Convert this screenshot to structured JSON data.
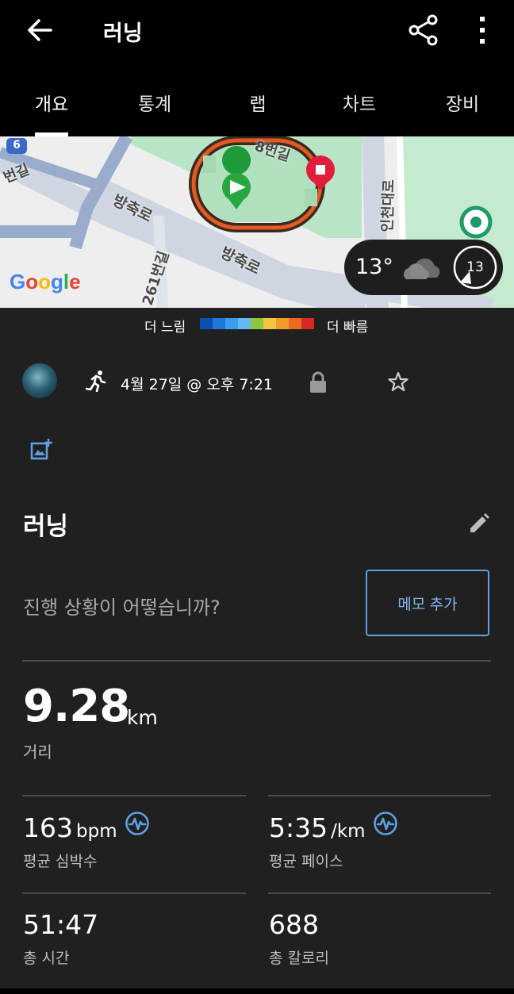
{
  "header": {
    "title": "러닝",
    "tabs": [
      "개요",
      "통계",
      "랩",
      "차트",
      "장비"
    ],
    "active_tab": 0
  },
  "map": {
    "road_labels": [
      "방축로",
      "방축로",
      "261번길",
      "인천대로",
      "8번길",
      "번길"
    ],
    "route_shield": "6",
    "google_logo_letters": [
      "G",
      "o",
      "o",
      "g",
      "l",
      "e"
    ],
    "weather": {
      "temperature": "13°",
      "condition_icon": "cloud-icon",
      "wind_speed": "13"
    }
  },
  "pace_legend": {
    "slow_label": "더 느림",
    "fast_label": "더 빠름",
    "colors": [
      "#0b4fb0",
      "#1f78d8",
      "#3b9cf0",
      "#66b7f2",
      "#8ec63f",
      "#f2c442",
      "#f29a2c",
      "#ea6b1f",
      "#d72a25"
    ]
  },
  "activity": {
    "date_time": "4월 27일 @ 오후 7:21",
    "name": "러닝",
    "prompt": "진행 상황이 어떻습니까?",
    "memo_button": "메모 추가"
  },
  "distance": {
    "value": "9.28",
    "unit": "km",
    "label": "거리"
  },
  "stats": {
    "avg_hr": {
      "value": "163",
      "unit": "bpm",
      "label": "평균 심박수"
    },
    "avg_pace": {
      "value": "5:35",
      "unit": "/km",
      "label": "평균 페이스"
    },
    "total_time": {
      "value": "51:47",
      "label": "총 시간"
    },
    "calories": {
      "value": "688",
      "label": "총 칼로리"
    }
  }
}
